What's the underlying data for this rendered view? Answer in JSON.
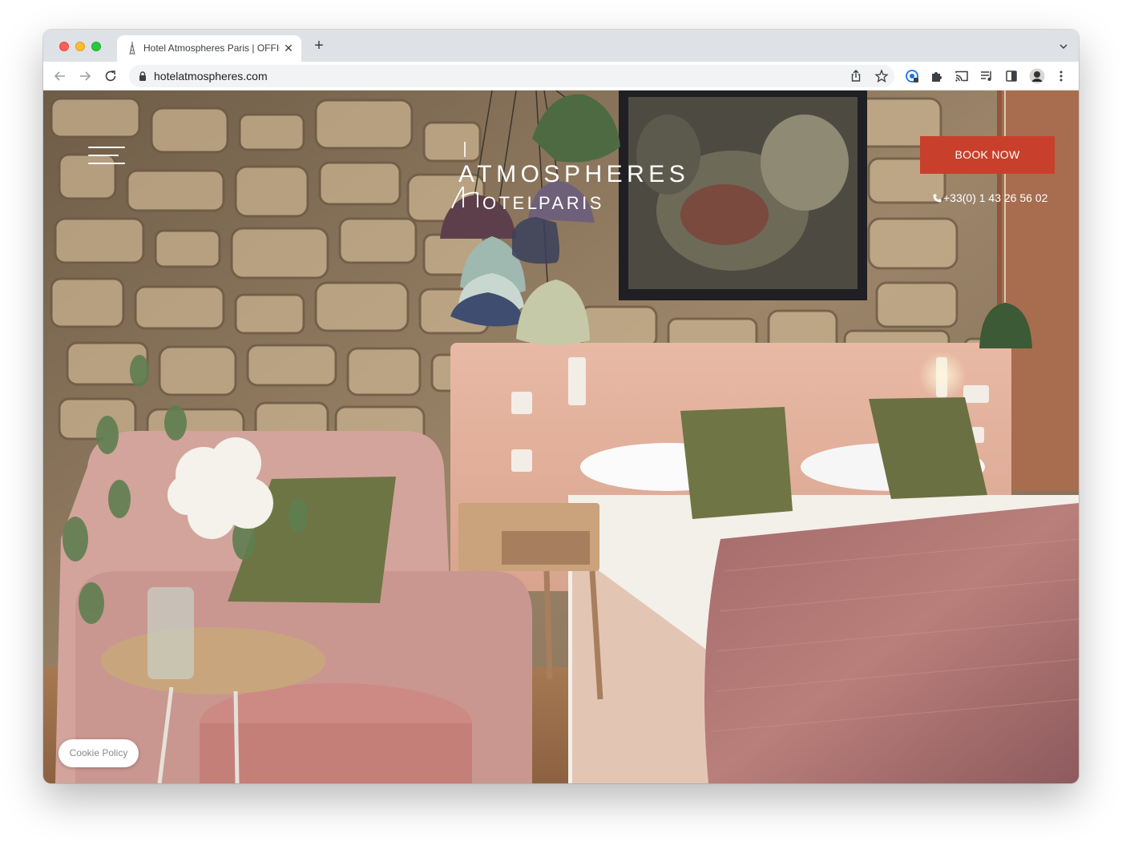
{
  "browser": {
    "tab_title": "Hotel Atmospheres Paris | OFFICIAL SITE",
    "new_tab_label": "+",
    "close_label": "✕",
    "url": "hotelatmospheres.com"
  },
  "header": {
    "logo_line1": "ATMOSPHERES",
    "logo_line2_hotel": "OTEL",
    "logo_line2_city": "PARIS",
    "book_label": "BOOK NOW",
    "phone": "+33(0) 1 43 26 56 02"
  },
  "footer": {
    "cookie_label": "Cookie Policy"
  },
  "colors": {
    "accent": "#c8402b",
    "text_on_image": "#ffffff",
    "browser_chrome": "#dee1e6"
  }
}
